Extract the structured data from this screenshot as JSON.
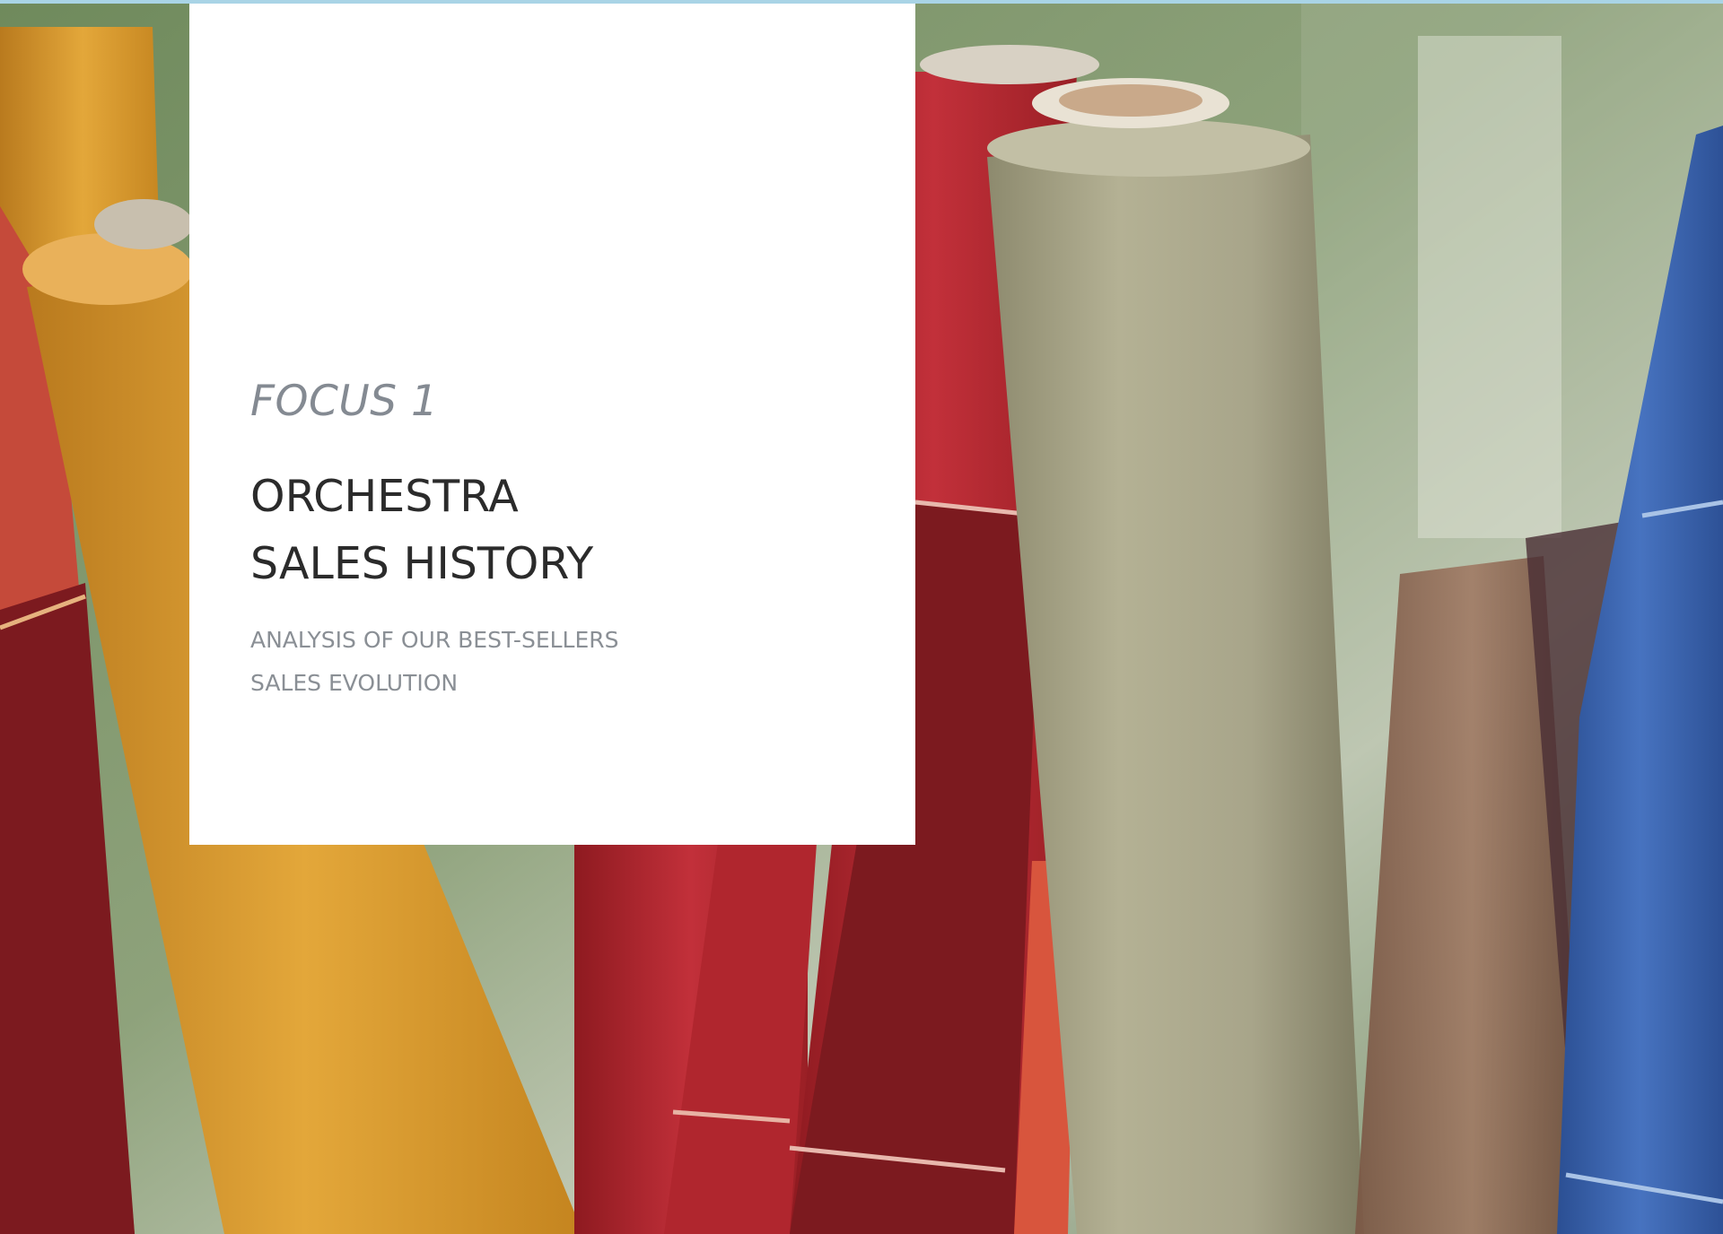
{
  "cover": {
    "kicker": "FOCUS 1",
    "title_lines": [
      "ORCHESTRA",
      "SALES HISTORY"
    ],
    "subtitle_lines": [
      "ANALYSIS OF OUR BEST-SELLERS",
      "SALES EVOLUTION"
    ]
  },
  "photo": {
    "subject": "rolls of fabric",
    "colors": {
      "border": "#a9d4e6",
      "yellow": "#d89a2c",
      "red": "#b3242c",
      "dark_red": "#7c1a1f",
      "coral": "#d8553d",
      "taupe": "#a7a487",
      "blue": "#3a64b0",
      "green": "#5d7a52"
    }
  }
}
